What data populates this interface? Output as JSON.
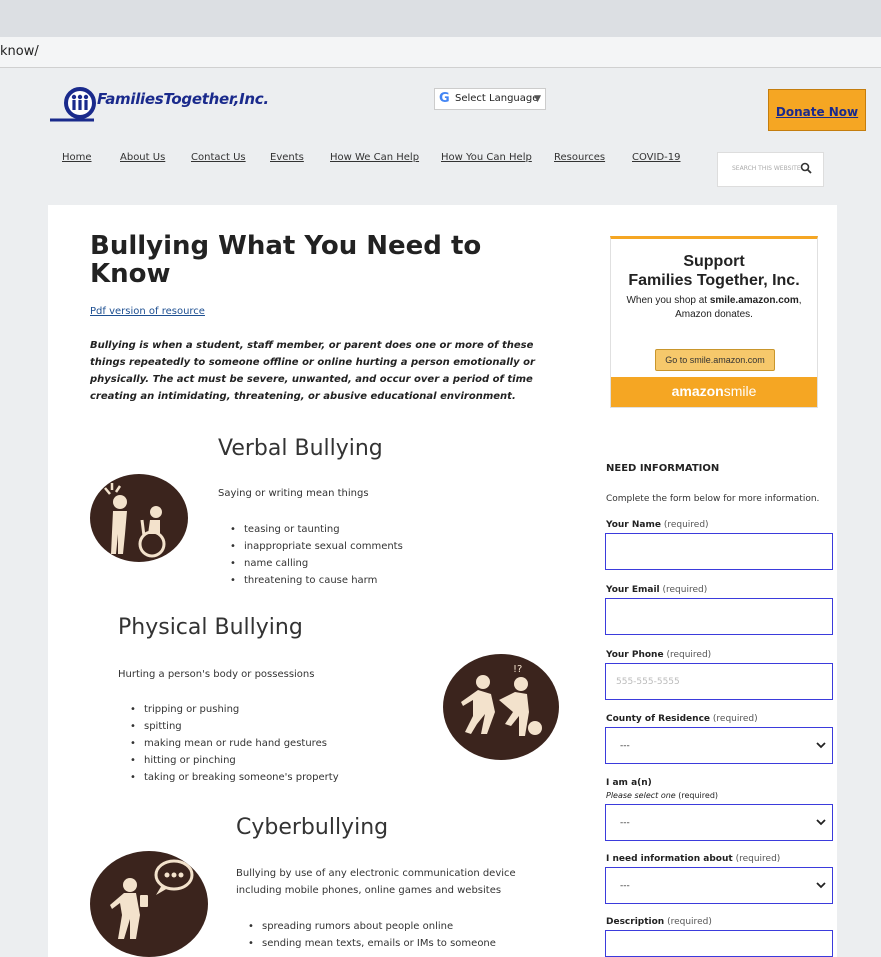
{
  "browser": {
    "url_fragment": "know/"
  },
  "header": {
    "logo_text": "FamiliesTogether,Inc.",
    "translate": {
      "g": "G",
      "label": "Select Language",
      "arrow": "▼"
    },
    "donate_label": "Donate Now"
  },
  "nav": {
    "items": [
      "Home",
      "About Us",
      "Contact Us",
      "Events",
      "How We Can Help",
      "How You Can Help",
      "Resources",
      "COVID-19"
    ],
    "search_placeholder": "SEARCH THIS WEBSITE"
  },
  "article": {
    "title": "Bullying What You Need to Know",
    "pdf_link": "Pdf version of resource",
    "intro": "Bullying is when a student, staff member, or parent does one or more of these things repeatedly to someone offline or online hurting a person emotionally or physically. The act must be severe, unwanted, and occur over a period of time creating an intimidating, threatening, or abusive educational environment.",
    "verbal": {
      "heading": "Verbal Bullying",
      "desc": "Saying or writing mean things",
      "items": [
        "teasing or taunting",
        "inappropriate sexual comments",
        "name calling",
        "threatening to cause harm"
      ]
    },
    "physical": {
      "heading": "Physical Bullying",
      "desc": "Hurting a person's body or possessions",
      "items": [
        "tripping or pushing",
        "spitting",
        "making mean or rude hand gestures",
        "hitting or pinching",
        "taking or breaking someone's property"
      ]
    },
    "cyber": {
      "heading": "Cyberbullying",
      "desc_line1": "Bullying by use of any electronic communication device",
      "desc_line2": "including mobile phones, online games and websites",
      "items": [
        "spreading rumors about people online",
        "sending mean texts, emails or IMs to someone"
      ]
    }
  },
  "sidebar": {
    "amazon": {
      "line1": "Support",
      "line2": "Families Together, Inc.",
      "line3_pre": "When you shop at ",
      "line3_bold": "smile.amazon.com",
      "line3_post": ",",
      "line4": "Amazon donates.",
      "button": "Go to smile.amazon.com",
      "brand_bold": "amazon",
      "brand_rest": "smile"
    },
    "form": {
      "title": "NEED INFORMATION",
      "desc": "Complete the form below for more information.",
      "required": "(required)",
      "name_label": "Your Name",
      "email_label": "Your Email",
      "phone_label": "Your Phone",
      "phone_placeholder": "555-555-5555",
      "county_label": "County of Residence",
      "county_value": "---",
      "iam_label": "I am a(n)",
      "iam_sub": "Please select one",
      "iam_value": "---",
      "need_label": "I need information about",
      "need_value": "---",
      "desc_label": "Description"
    }
  },
  "colors": {
    "brand_blue": "#1a2a8c",
    "donate_orange": "#f5a623",
    "icon_brown": "#3b241d",
    "field_border": "#3b3bdc"
  }
}
